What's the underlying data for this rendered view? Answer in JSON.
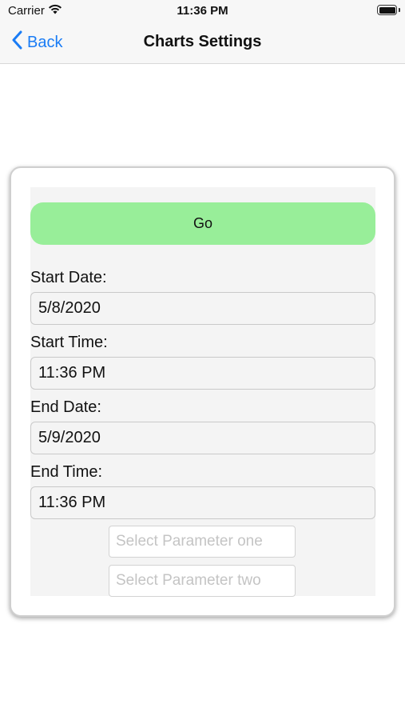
{
  "status_bar": {
    "carrier": "Carrier",
    "time": "11:36 PM"
  },
  "nav": {
    "back_label": "Back",
    "title": "Charts Settings"
  },
  "form": {
    "go_label": "Go",
    "start_date_label": "Start Date:",
    "start_date_value": "5/8/2020",
    "start_time_label": "Start Time:",
    "start_time_value": "11:36 PM",
    "end_date_label": "End Date:",
    "end_date_value": "5/9/2020",
    "end_time_label": "End Time:",
    "end_time_value": "11:36 PM",
    "param_one_placeholder": "Select Parameter one",
    "param_two_placeholder": "Select Parameter two"
  },
  "colors": {
    "accent": "#1a7cf5",
    "go_button": "#98ee99",
    "panel_background": "#f4f4f4"
  },
  "icons": {
    "wifi": "wifi-icon",
    "battery": "battery-icon",
    "back": "chevron-left-icon"
  }
}
